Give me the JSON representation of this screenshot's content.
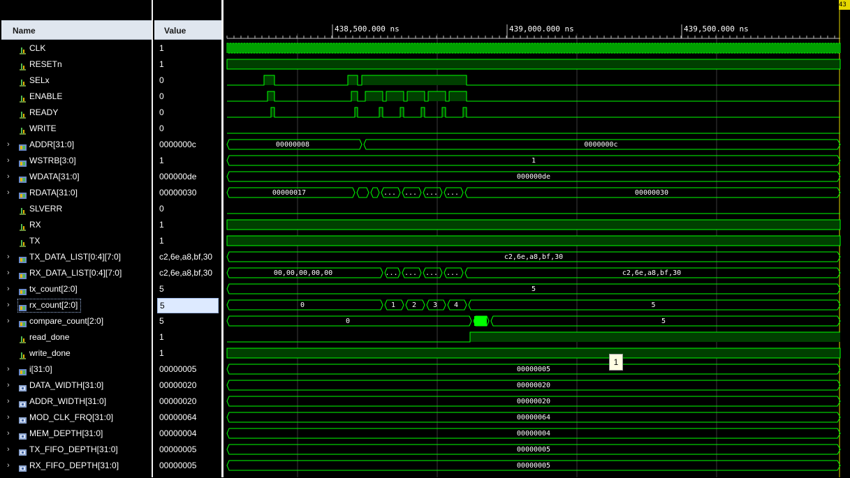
{
  "headers": {
    "name": "Name",
    "value": "Value"
  },
  "timeline": {
    "ticks": [
      "438,500.000 ns",
      "439,000.000 ns",
      "439,500.000 ns"
    ],
    "cursor_label": "43"
  },
  "tooltip": "1",
  "colors": {
    "wave": "#00ff00",
    "bus_fill": "#003f00",
    "background": "#000000",
    "grid": "#3a3a3a"
  },
  "signals": [
    {
      "name": "CLK",
      "value": "1",
      "kind": "clock",
      "icon": "bit-signal-icon",
      "expandable": false
    },
    {
      "name": "RESETn",
      "value": "1",
      "kind": "high",
      "icon": "bit-signal-icon",
      "expandable": false
    },
    {
      "name": "SELx",
      "value": "0",
      "kind": "pulses",
      "icon": "bit-signal-icon",
      "expandable": false
    },
    {
      "name": "ENABLE",
      "value": "0",
      "kind": "pulses",
      "icon": "bit-signal-icon",
      "expandable": false
    },
    {
      "name": "READY",
      "value": "0",
      "kind": "pulses",
      "icon": "bit-signal-icon",
      "expandable": false
    },
    {
      "name": "WRITE",
      "value": "0",
      "kind": "low",
      "icon": "bit-signal-icon",
      "expandable": false
    },
    {
      "name": "ADDR[31:0]",
      "value": "0000000c",
      "kind": "bus",
      "icon": "bus-signal-icon",
      "expandable": true,
      "segments": [
        "00000008",
        "0000000c"
      ]
    },
    {
      "name": "WSTRB[3:0]",
      "value": "1",
      "kind": "bus",
      "icon": "bus-signal-icon",
      "expandable": true,
      "segments": [
        "1"
      ]
    },
    {
      "name": "WDATA[31:0]",
      "value": "000000de",
      "kind": "bus",
      "icon": "bus-signal-icon",
      "expandable": true,
      "segments": [
        "000000de"
      ]
    },
    {
      "name": "RDATA[31:0]",
      "value": "00000030",
      "kind": "bus",
      "icon": "bus-signal-icon",
      "expandable": true,
      "segments": [
        "00000017",
        "...",
        "...",
        "...",
        "...",
        "00000030"
      ]
    },
    {
      "name": "SLVERR",
      "value": "0",
      "kind": "low",
      "icon": "bit-signal-icon",
      "expandable": false
    },
    {
      "name": "RX",
      "value": "1",
      "kind": "high",
      "icon": "bit-signal-icon",
      "expandable": false
    },
    {
      "name": "TX",
      "value": "1",
      "kind": "high",
      "icon": "bit-signal-icon",
      "expandable": false
    },
    {
      "name": "TX_DATA_LIST[0:4][7:0]",
      "value": "c2,6e,a8,bf,30",
      "kind": "bus",
      "icon": "bus-signal-icon",
      "expandable": true,
      "segments": [
        "c2,6e,a8,bf,30"
      ]
    },
    {
      "name": "RX_DATA_LIST[0:4][7:0]",
      "value": "c2,6e,a8,bf,30",
      "kind": "bus",
      "icon": "bus-signal-icon",
      "expandable": true,
      "segments": [
        "00,00,00,00,00",
        "...",
        "...",
        "...",
        "...",
        "c2,6e,a8,bf,30"
      ]
    },
    {
      "name": "tx_count[2:0]",
      "value": "5",
      "kind": "bus",
      "icon": "bus-signal-icon",
      "expandable": true,
      "segments": [
        "5"
      ]
    },
    {
      "name": "rx_count[2:0]",
      "value": "5",
      "kind": "bus",
      "icon": "bus-signal-icon",
      "expandable": true,
      "selected": true,
      "segments": [
        "0",
        "1",
        "2",
        "3",
        "4",
        "5"
      ]
    },
    {
      "name": "compare_count[2:0]",
      "value": "5",
      "kind": "bus",
      "icon": "bus-signal-icon",
      "expandable": true,
      "segments": [
        "0",
        "",
        "5"
      ]
    },
    {
      "name": "read_done",
      "value": "1",
      "kind": "step",
      "icon": "bit-signal-icon",
      "expandable": false
    },
    {
      "name": "write_done",
      "value": "1",
      "kind": "high",
      "icon": "bit-signal-icon",
      "expandable": false
    },
    {
      "name": "i[31:0]",
      "value": "00000005",
      "kind": "bus",
      "icon": "bus-signal-icon",
      "expandable": true,
      "segments": [
        "00000005"
      ]
    },
    {
      "name": "DATA_WIDTH[31:0]",
      "value": "00000020",
      "kind": "bus",
      "icon": "param-signal-icon",
      "expandable": true,
      "segments": [
        "00000020"
      ]
    },
    {
      "name": "ADDR_WIDTH[31:0]",
      "value": "00000020",
      "kind": "bus",
      "icon": "param-signal-icon",
      "expandable": true,
      "segments": [
        "00000020"
      ]
    },
    {
      "name": "MOD_CLK_FRQ[31:0]",
      "value": "00000064",
      "kind": "bus",
      "icon": "param-signal-icon",
      "expandable": true,
      "segments": [
        "00000064"
      ]
    },
    {
      "name": "MEM_DEPTH[31:0]",
      "value": "00000004",
      "kind": "bus",
      "icon": "param-signal-icon",
      "expandable": true,
      "segments": [
        "00000004"
      ]
    },
    {
      "name": "TX_FIFO_DEPTH[31:0]",
      "value": "00000005",
      "kind": "bus",
      "icon": "param-signal-icon",
      "expandable": true,
      "segments": [
        "00000005"
      ]
    },
    {
      "name": "RX_FIFO_DEPTH[31:0]",
      "value": "00000005",
      "kind": "bus",
      "icon": "param-signal-icon",
      "expandable": true,
      "segments": [
        "00000005"
      ]
    }
  ]
}
